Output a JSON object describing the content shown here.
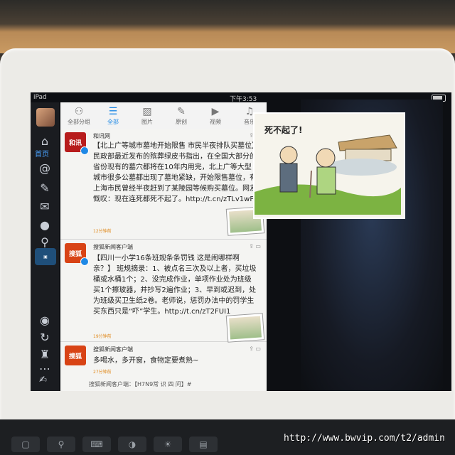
{
  "device": {
    "carrier": "iPad",
    "time": "下午3:53"
  },
  "overlay_url": "http://www.bwvip.com/t2/admin",
  "sidebar": {
    "home_label": "首页"
  },
  "toolbar": {
    "items": [
      {
        "label": "全部分组",
        "icon": "people-icon"
      },
      {
        "label": "全部",
        "icon": "list-icon"
      },
      {
        "label": "图片",
        "icon": "image-icon"
      },
      {
        "label": "原创",
        "icon": "pen-icon"
      },
      {
        "label": "视频",
        "icon": "play-icon"
      },
      {
        "label": "音乐",
        "icon": "music-icon"
      }
    ],
    "active_index": 1
  },
  "posts": [
    {
      "author": "和讯网",
      "logo_text": "和讯",
      "logo_color": "#b71c1c",
      "body": "【北上广等城市墓地开始限售 市民半夜排队买墓位】民政部最近发布的殡葬绿皮书指出，在全国大部分的省份现有的墓穴都将在10年内用完，北上广等大型城市很多公墓都出现了墓地紧缺，开始限售墓位，有上海市民曾经半夜赶到了某陵园等候购买墓位。网友慨叹：现在连死都死不起了。http://t.cn/zTLv1wP",
      "meta": "12分钟前"
    },
    {
      "author": "搜狐新闻客户端",
      "logo_text": "搜狐",
      "logo_color": "#d84315",
      "body": "【四川一小学16条班规条条罚钱 这是闹哪样啊亲？】 班规摘录：1、被点名三次及以上者，买垃圾桶或水桶1个；2、没完成作业，单项作业处为班级买1个擦玻器，并抄写2遍作业；3、早到或迟到，处为班级买卫生纸2卷。老师说，惩罚办法中的罚学生买东西只是“吓”学生。http://t.cn/zT2FUI1",
      "meta": "19分钟前"
    },
    {
      "author": "搜狐新闻客户端",
      "logo_text": "搜狐",
      "logo_color": "#d84315",
      "body": "多喝水，多开窗，食物定要煮熟~",
      "meta": "27分钟前"
    }
  ],
  "bottom_preview": "搜狐新闻客户端：【H7N9常 识 四 问】#",
  "cartoon_caption": "死不起了!",
  "colors": {
    "accent": "#1e88e5",
    "meta": "#e08a1e"
  }
}
